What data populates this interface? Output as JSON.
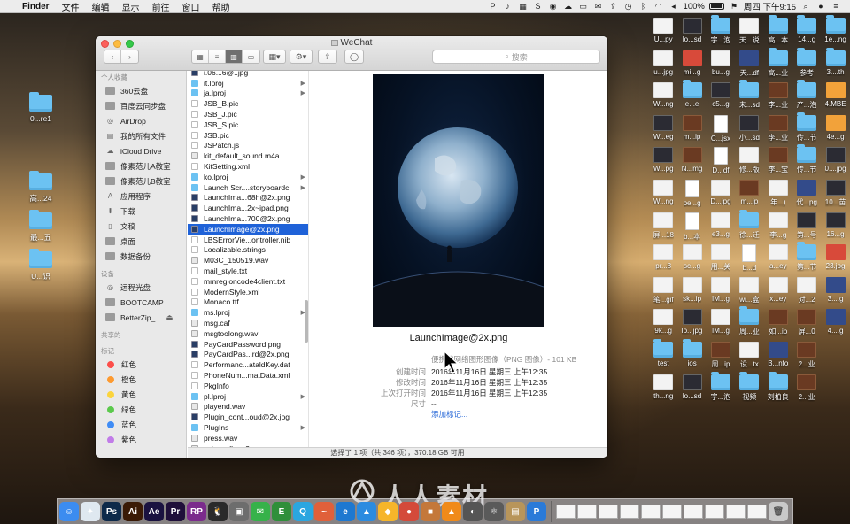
{
  "menubar": {
    "finder": "Finder",
    "items": [
      "文件",
      "编辑",
      "显示",
      "前往",
      "窗口",
      "帮助"
    ],
    "battery": "100%",
    "clock": "周四 下午9:15"
  },
  "desktop_left": [
    {
      "label": "0...re1"
    },
    {
      "label": "高...24"
    },
    {
      "label": "最...五"
    },
    {
      "label": "U...识"
    }
  ],
  "desktop_right": [
    "U...py",
    "lo...sd",
    "字...泡",
    "天...说",
    "高...本",
    "14...g",
    "1e...ng",
    "u...jpg",
    "mi...g",
    "bu...g",
    "天...df",
    "高...业",
    "参考",
    "3....th",
    "W...ng",
    "e...e",
    "c5...g",
    "未...sd",
    "李...业",
    "产...泡",
    "4.MBE",
    "W...eg",
    "m...ip",
    "C...jsx",
    "小...sd",
    "李...业",
    "传...节",
    "4e...g",
    "W...pg",
    "N...mg",
    "D...df",
    "修...版",
    "李...宝",
    "传...节",
    "0....jpg",
    "W...ng",
    "pe...g",
    "D...jpg",
    "m...ip",
    "年...)",
    "代...pg",
    "10...苗",
    "屏...18",
    "b...本",
    "e3...g",
    "徐...迁",
    "李...g",
    "第...号",
    "16...g",
    "pr...8",
    "sc...g",
    "用...关",
    "b...d",
    "a...ey",
    "第...节",
    "23.jpg",
    "笔...gif",
    "sk...ip",
    "IM...g",
    "wi...盒",
    "x...ey",
    "对...2",
    "3....g",
    "9k...g",
    "lo...jpg",
    "IM...g",
    "周...业",
    "如...ip",
    "屏...0",
    "4....g",
    "test",
    "ios",
    "周...ip",
    "设...tx",
    "B...nfo",
    "2...业",
    "",
    "th...ng",
    "lo...sd",
    "字...泡",
    "视频",
    "刘柏良",
    "2...业",
    ""
  ],
  "finder": {
    "window_title": "WeChat",
    "search_placeholder": "搜索",
    "sidebar": {
      "favorites_head": "个人收藏",
      "favorites": [
        "360云盘",
        "百度云同步盘",
        "AirDrop",
        "我的所有文件",
        "iCloud Drive",
        "像素范儿A教室",
        "像素范儿B教室",
        "应用程序",
        "下载",
        "文稿",
        "桌面",
        "数据备份"
      ],
      "devices_head": "设备",
      "devices": [
        "远程光盘",
        "BOOTCAMP",
        "BetterZip_..."
      ],
      "shared_head": "共享的",
      "tags_head": "标记",
      "tags": [
        {
          "name": "红色",
          "color": "#fc4e4a"
        },
        {
          "name": "橙色",
          "color": "#fd9a30"
        },
        {
          "name": "黄色",
          "color": "#fbd43c"
        },
        {
          "name": "绿色",
          "color": "#5bc94c"
        },
        {
          "name": "蓝色",
          "color": "#3f8cf5"
        },
        {
          "name": "紫色",
          "color": "#c17ce8"
        }
      ]
    },
    "files": [
      {
        "name": "i.06...6@..jpg",
        "icon": "img"
      },
      {
        "name": "it.lproj",
        "icon": "folder",
        "arrow": true
      },
      {
        "name": "ja.lproj",
        "icon": "folder",
        "arrow": true
      },
      {
        "name": "JSB_B.pic",
        "icon": "file"
      },
      {
        "name": "JSB_J.pic",
        "icon": "file"
      },
      {
        "name": "JSB_S.pic",
        "icon": "file"
      },
      {
        "name": "JSB.pic",
        "icon": "file"
      },
      {
        "name": "JSPatch.js",
        "icon": "file"
      },
      {
        "name": "kit_default_sound.m4a",
        "icon": "audio"
      },
      {
        "name": "KitSetting.xml",
        "icon": "file"
      },
      {
        "name": "ko.lproj",
        "icon": "folder",
        "arrow": true
      },
      {
        "name": "Launch Scr....storyboardc",
        "icon": "folder",
        "arrow": true
      },
      {
        "name": "LaunchIma...68h@2x.png",
        "icon": "img"
      },
      {
        "name": "LaunchIma...2x~ipad.png",
        "icon": "img"
      },
      {
        "name": "LaunchIma...700@2x.png",
        "icon": "img"
      },
      {
        "name": "LaunchImage@2x.png",
        "icon": "img",
        "selected": true
      },
      {
        "name": "LBSErrorVie...ontroller.nib",
        "icon": "file"
      },
      {
        "name": "Localizable.strings",
        "icon": "file"
      },
      {
        "name": "M03C_150519.wav",
        "icon": "audio"
      },
      {
        "name": "mail_style.txt",
        "icon": "file"
      },
      {
        "name": "mmregioncode4client.txt",
        "icon": "file"
      },
      {
        "name": "ModernStyle.xml",
        "icon": "file"
      },
      {
        "name": "Monaco.ttf",
        "icon": "file"
      },
      {
        "name": "ms.lproj",
        "icon": "folder",
        "arrow": true
      },
      {
        "name": "msg.caf",
        "icon": "audio"
      },
      {
        "name": "msgtoolong.wav",
        "icon": "audio"
      },
      {
        "name": "PayCardPassword.png",
        "icon": "img"
      },
      {
        "name": "PayCardPas...rd@2x.png",
        "icon": "img"
      },
      {
        "name": "Performanc...ataldKey.dat",
        "icon": "file"
      },
      {
        "name": "PhoneNum...matData.xml",
        "icon": "file"
      },
      {
        "name": "PkgInfo",
        "icon": "file"
      },
      {
        "name": "pl.lproj",
        "icon": "folder",
        "arrow": true
      },
      {
        "name": "playend.wav",
        "icon": "audio"
      },
      {
        "name": "Plugin_cont...oud@2x.jpg",
        "icon": "img"
      },
      {
        "name": "PlugIns",
        "icon": "folder",
        "arrow": true
      },
      {
        "name": "press.wav",
        "icon": "audio"
      },
      {
        "name": "pstnscall.mp3",
        "icon": "audio"
      }
    ],
    "preview": {
      "filename": "LaunchImage@2x.png",
      "kind_label": "便携式网络图形图像（PNG 图像）- 101 KB",
      "meta": [
        {
          "key": "创建时间",
          "value": "2016年11月16日 星期三 上午12:35"
        },
        {
          "key": "修改时间",
          "value": "2016年11月16日 星期三 上午12:35"
        },
        {
          "key": "上次打开时间",
          "value": "2016年11月16日 星期三 上午12:35"
        },
        {
          "key": "尺寸",
          "value": "--"
        }
      ],
      "add_tags": "添加标记..."
    },
    "status": "选择了 1 项（共 346 项），370.18 GB 可用"
  },
  "watermark": "人人素材",
  "dock_icons": [
    {
      "name": "finder-icon",
      "color": "#3c8cf0",
      "glyph": "☺"
    },
    {
      "name": "safari-icon",
      "color": "#dfe8f0",
      "glyph": "✦"
    },
    {
      "name": "photoshop-icon",
      "color": "#0e2a4a",
      "glyph": "Ps"
    },
    {
      "name": "illustrator-icon",
      "color": "#3a1a06",
      "glyph": "Ai"
    },
    {
      "name": "after-effects-icon",
      "color": "#1a1240",
      "glyph": "Ae"
    },
    {
      "name": "premiere-icon",
      "color": "#1f0f3a",
      "glyph": "Pr"
    },
    {
      "name": "rp-icon",
      "color": "#7b2b8c",
      "glyph": "RP"
    },
    {
      "name": "qq-icon",
      "color": "#2a2a2a",
      "glyph": "🐧"
    },
    {
      "name": "photo-booth-icon",
      "color": "#6d6d6d",
      "glyph": "▣"
    },
    {
      "name": "wechat-icon",
      "color": "#36b24a",
      "glyph": "✉"
    },
    {
      "name": "evernote-icon",
      "color": "#2f8f3a",
      "glyph": "E"
    },
    {
      "name": "tencent-qq-browser-icon",
      "color": "#2ba6e0",
      "glyph": "Q"
    },
    {
      "name": "fish-icon",
      "color": "#e0603a",
      "glyph": "~"
    },
    {
      "name": "edge-icon",
      "color": "#1e78d0",
      "glyph": "e"
    },
    {
      "name": "keynote-icon",
      "color": "#2b8be0",
      "glyph": "▲"
    },
    {
      "name": "sketch-icon",
      "color": "#f6b52a",
      "glyph": "◆"
    },
    {
      "name": "chrome-icon",
      "color": "#d44a3a",
      "glyph": "●"
    },
    {
      "name": "toolbox-icon",
      "color": "#c4783a",
      "glyph": "■"
    },
    {
      "name": "vlc-icon",
      "color": "#f08a1a",
      "glyph": "▲"
    },
    {
      "name": "utility-icon",
      "color": "#555",
      "glyph": "◐"
    },
    {
      "name": "atom-icon",
      "color": "#5a5a5a",
      "glyph": "⚛"
    },
    {
      "name": "package-icon",
      "color": "#b8955a",
      "glyph": "▤"
    },
    {
      "name": "pockyt-icon",
      "color": "#2a7ad8",
      "glyph": "P"
    }
  ]
}
